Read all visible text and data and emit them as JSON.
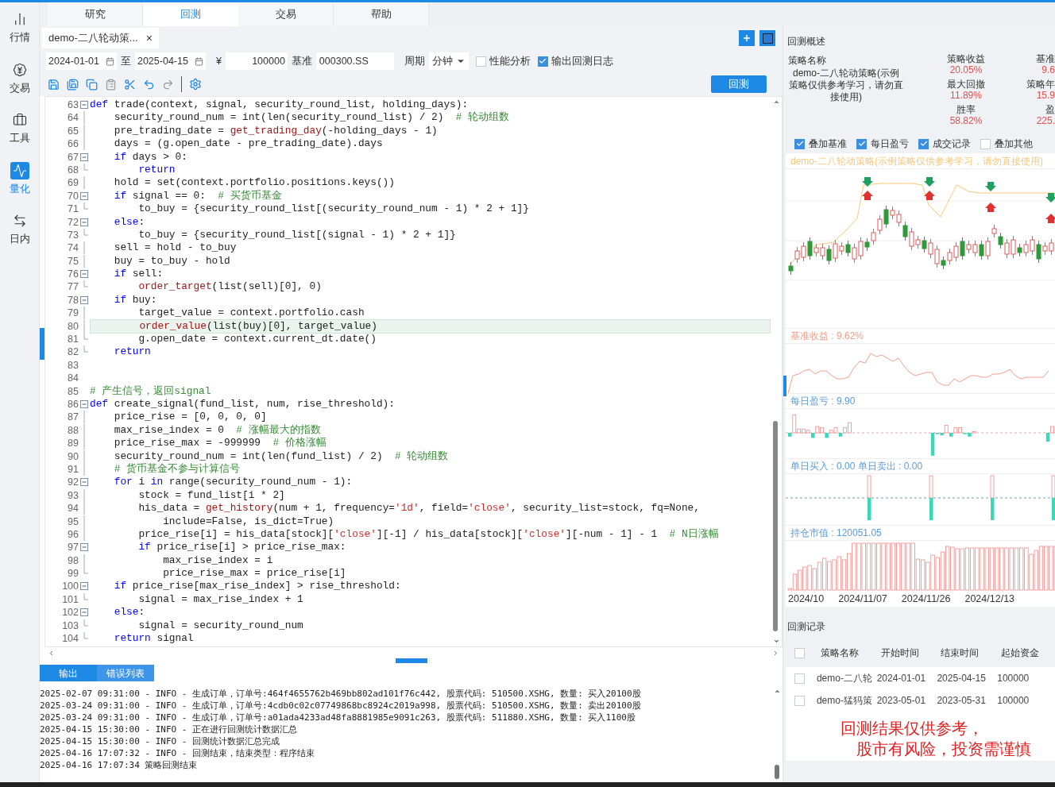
{
  "sidebar": {
    "items": [
      {
        "label": "行情",
        "selected": false
      },
      {
        "label": "交易",
        "selected": false
      },
      {
        "label": "工具",
        "selected": false
      },
      {
        "label": "量化",
        "selected": true
      },
      {
        "label": "日内",
        "selected": false
      }
    ]
  },
  "top_tabs": [
    {
      "label": "研究",
      "selected": false
    },
    {
      "label": "回测",
      "selected": true
    },
    {
      "label": "交易",
      "selected": false
    },
    {
      "label": "帮助",
      "selected": false
    }
  ],
  "editor": {
    "file_tab": {
      "label": "demo-二八轮动策...",
      "close": "×"
    },
    "params": {
      "start_date": "2024-01-01",
      "to": "至",
      "end_date": "2025-04-15",
      "currency": "¥",
      "capital": "100000",
      "benchmark_label": "基准",
      "benchmark": "000300.SS",
      "period_label": "周期",
      "period": "分钟",
      "perf": {
        "label": "性能分析",
        "checked": false
      },
      "log": {
        "label": "输出回测日志",
        "checked": true
      }
    },
    "run_button": "回测",
    "lines": [
      {
        "n": "63",
        "kind": "fold_start",
        "segs": [
          {
            "kind": "kw",
            "text": "def"
          },
          {
            "kind": "p",
            "text": " trade(context, signal, security_round_list, holding_days):"
          }
        ]
      },
      {
        "n": "64",
        "kind": "fold_body",
        "segs": [
          {
            "kind": "p",
            "text": "    security_round_num = int(len(security_round_list) / 2)  "
          },
          {
            "kind": "cm",
            "text": "# 轮动组数"
          }
        ]
      },
      {
        "n": "65",
        "kind": "fold_body",
        "segs": [
          {
            "kind": "p",
            "text": "    pre_trading_date = "
          },
          {
            "kind": "fn",
            "text": "get_trading_day"
          },
          {
            "kind": "p",
            "text": "(-holding_days - 1)"
          }
        ]
      },
      {
        "n": "66",
        "kind": "fold_body",
        "segs": [
          {
            "kind": "p",
            "text": "    days = (g.open_date - pre_trading_date).days"
          }
        ]
      },
      {
        "n": "67",
        "kind": "fold_start",
        "segs": [
          {
            "kind": "kw",
            "text": "    if"
          },
          {
            "kind": "p",
            "text": " days > 0:"
          }
        ]
      },
      {
        "n": "68",
        "kind": "fold_end",
        "segs": [
          {
            "kind": "kw",
            "text": "        return"
          }
        ]
      },
      {
        "n": "69",
        "kind": "fold_body",
        "segs": [
          {
            "kind": "p",
            "text": "    hold = set(context.portfolio.positions.keys())"
          }
        ]
      },
      {
        "n": "70",
        "kind": "fold_start",
        "segs": [
          {
            "kind": "kw",
            "text": "    if"
          },
          {
            "kind": "p",
            "text": " signal == 0:  "
          },
          {
            "kind": "cm",
            "text": "# 买货币基金"
          }
        ]
      },
      {
        "n": "71",
        "kind": "fold_end",
        "segs": [
          {
            "kind": "p",
            "text": "        to_buy = {security_round_list[(security_round_num - 1) * 2 + 1]}"
          }
        ]
      },
      {
        "n": "72",
        "kind": "fold_start",
        "segs": [
          {
            "kind": "kw",
            "text": "    else"
          },
          {
            "kind": "p",
            "text": ":"
          }
        ]
      },
      {
        "n": "73",
        "kind": "fold_end",
        "segs": [
          {
            "kind": "p",
            "text": "        to_buy = {security_round_list[(signal - 1) * 2 + 1]}"
          }
        ]
      },
      {
        "n": "74",
        "kind": "fold_body",
        "segs": [
          {
            "kind": "p",
            "text": "    sell = hold - to_buy"
          }
        ]
      },
      {
        "n": "75",
        "kind": "fold_body",
        "segs": [
          {
            "kind": "p",
            "text": "    buy = to_buy - hold"
          }
        ]
      },
      {
        "n": "76",
        "kind": "fold_start",
        "segs": [
          {
            "kind": "kw",
            "text": "    if"
          },
          {
            "kind": "p",
            "text": " sell:"
          }
        ]
      },
      {
        "n": "77",
        "kind": "fold_end",
        "segs": [
          {
            "kind": "fn",
            "text": "        order_target"
          },
          {
            "kind": "p",
            "text": "(list(sell)[0], 0)"
          }
        ]
      },
      {
        "n": "78",
        "kind": "fold_start",
        "segs": [
          {
            "kind": "kw",
            "text": "    if"
          },
          {
            "kind": "p",
            "text": " buy:"
          }
        ]
      },
      {
        "n": "79",
        "kind": "fold_body",
        "segs": [
          {
            "kind": "p",
            "text": "        target_value = context.portfolio.cash"
          }
        ]
      },
      {
        "n": "80",
        "kind": "fold_body",
        "current": true,
        "segs": [
          {
            "kind": "fn",
            "text": "        order_value"
          },
          {
            "kind": "p",
            "text": "(list(buy)[0], target_value)"
          }
        ]
      },
      {
        "n": "81",
        "kind": "fold_end",
        "segs": [
          {
            "kind": "p",
            "text": "        g.open_date = context.current_dt.date()"
          }
        ]
      },
      {
        "n": "82",
        "kind": "fold_end",
        "segs": [
          {
            "kind": "kw",
            "text": "    return"
          }
        ]
      },
      {
        "n": "83",
        "kind": "plain"
      },
      {
        "n": "84",
        "kind": "plain"
      },
      {
        "n": "85",
        "kind": "plain",
        "segs": [
          {
            "kind": "cm",
            "text": "# 产生信号，返回signal"
          }
        ]
      },
      {
        "n": "86",
        "kind": "fold_start",
        "segs": [
          {
            "kind": "kw",
            "text": "def"
          },
          {
            "kind": "p",
            "text": " create_signal(fund_list, num, rise_threshold):"
          }
        ]
      },
      {
        "n": "87",
        "kind": "fold_body",
        "segs": [
          {
            "kind": "p",
            "text": "    price_rise = [0, 0, 0, 0]"
          }
        ]
      },
      {
        "n": "88",
        "kind": "fold_body",
        "segs": [
          {
            "kind": "p",
            "text": "    max_rise_index = 0  "
          },
          {
            "kind": "cm",
            "text": "# 涨幅最大的指数"
          }
        ]
      },
      {
        "n": "89",
        "kind": "fold_body",
        "segs": [
          {
            "kind": "p",
            "text": "    price_rise_max = -999999  "
          },
          {
            "kind": "cm",
            "text": "# 价格涨幅"
          }
        ]
      },
      {
        "n": "90",
        "kind": "fold_body",
        "segs": [
          {
            "kind": "p",
            "text": "    security_round_num = int(len(fund_list) / 2)  "
          },
          {
            "kind": "cm",
            "text": "# 轮动组数"
          }
        ]
      },
      {
        "n": "91",
        "kind": "fold_body",
        "segs": [
          {
            "kind": "cm",
            "text": "    # 货币基金不参与计算信号"
          }
        ]
      },
      {
        "n": "92",
        "kind": "fold_start",
        "segs": [
          {
            "kind": "kw",
            "text": "    for"
          },
          {
            "kind": "p",
            "text": " i "
          },
          {
            "kind": "kw",
            "text": "in"
          },
          {
            "kind": "p",
            "text": " range(security_round_num - 1):"
          }
        ]
      },
      {
        "n": "93",
        "kind": "fold_body",
        "segs": [
          {
            "kind": "p",
            "text": "        stock = fund_list[i * 2]"
          }
        ]
      },
      {
        "n": "94",
        "kind": "fold_body",
        "segs": [
          {
            "kind": "p",
            "text": "        his_data = "
          },
          {
            "kind": "fn",
            "text": "get_history"
          },
          {
            "kind": "p",
            "text": "(num + 1, frequency="
          },
          {
            "kind": "str",
            "text": "'1d'"
          },
          {
            "kind": "p",
            "text": ", field="
          },
          {
            "kind": "str",
            "text": "'close'"
          },
          {
            "kind": "p",
            "text": ", security_list=stock, fq=None,"
          }
        ]
      },
      {
        "n": "95",
        "kind": "fold_body",
        "segs": [
          {
            "kind": "p",
            "text": "            include=False, is_dict=True)"
          }
        ]
      },
      {
        "n": "96",
        "kind": "fold_body",
        "segs": [
          {
            "kind": "p",
            "text": "        price_rise[i] = his_data[stock]["
          },
          {
            "kind": "str",
            "text": "'close'"
          },
          {
            "kind": "p",
            "text": "][-1] / his_data[stock]["
          },
          {
            "kind": "str",
            "text": "'close'"
          },
          {
            "kind": "p",
            "text": "][-num - 1] - 1  "
          },
          {
            "kind": "cm",
            "text": "# N日涨幅"
          }
        ]
      },
      {
        "n": "97",
        "kind": "fold_start",
        "segs": [
          {
            "kind": "kw",
            "text": "        if"
          },
          {
            "kind": "p",
            "text": " price_rise[i] > price_rise_max:"
          }
        ]
      },
      {
        "n": "98",
        "kind": "fold_body",
        "segs": [
          {
            "kind": "p",
            "text": "            max_rise_index = i"
          }
        ]
      },
      {
        "n": "99",
        "kind": "fold_end",
        "segs": [
          {
            "kind": "p",
            "text": "            price_rise_max = price_rise[i]"
          }
        ]
      },
      {
        "n": "100",
        "kind": "fold_start",
        "segs": [
          {
            "kind": "kw",
            "text": "    if"
          },
          {
            "kind": "p",
            "text": " price_rise[max_rise_index] > rise_threshold:"
          }
        ]
      },
      {
        "n": "101",
        "kind": "fold_end",
        "segs": [
          {
            "kind": "p",
            "text": "        signal = max_rise_index + 1"
          }
        ]
      },
      {
        "n": "102",
        "kind": "fold_start",
        "segs": [
          {
            "kind": "kw",
            "text": "    else"
          },
          {
            "kind": "p",
            "text": ":"
          }
        ]
      },
      {
        "n": "103",
        "kind": "fold_end",
        "segs": [
          {
            "kind": "p",
            "text": "        signal = security_round_num"
          }
        ]
      },
      {
        "n": "104",
        "kind": "fold_end",
        "segs": [
          {
            "kind": "kw",
            "text": "    return"
          },
          {
            "kind": "p",
            "text": " signal"
          }
        ]
      }
    ],
    "output_tabs": [
      {
        "label": "输出",
        "selected": true
      },
      {
        "label": "错误列表",
        "selected": false
      }
    ],
    "log": [
      "2025-02-07 09:31:00 - INFO - 生成订单，订单号:464f4655762b469bb802ad101f76c442, 股票代码: 510500.XSHG, 数量: 买入20100股",
      "2025-03-24 09:31:00 - INFO - 生成订单，订单号:4cdb0c02c07749868bc8924c2019a998, 股票代码: 510500.XSHG, 数量: 卖出20100股",
      "2025-03-24 09:31:00 - INFO - 生成订单，订单号:a01ada4233ad48fa8881985e9091c263, 股票代码: 511880.XSHG, 数量: 买入1100股",
      "2025-04-15 15:30:00 - INFO - 正在进行回测统计数据汇总",
      "2025-04-15 15:30:00 - INFO - 回测统计数据汇总完成",
      "2025-04-16 17:07:32 - INFO - 回测结束，结束类型：程序结束",
      "2025-04-16 17:07:34 策略回测结束"
    ]
  },
  "summary": {
    "title": "回测概述",
    "name_label": "策略名称",
    "name_value": "demo-二八轮动策略(示例策略仅供参考学习，请勿直接使用)",
    "stats": [
      {
        "label": "策略收益",
        "value": "20.05%"
      },
      {
        "label": "基准",
        "value": "9.6"
      },
      {
        "label": "最大回撤",
        "value": "11.89%"
      },
      {
        "label": "策略年",
        "value": "15.9"
      },
      {
        "label": "胜率",
        "value": "58.82%"
      },
      {
        "label": "盈",
        "value": "225."
      }
    ],
    "overlays": [
      {
        "label": "叠加基准",
        "checked": true
      },
      {
        "label": "每日盈亏",
        "checked": true
      },
      {
        "label": "成交记录",
        "checked": true
      },
      {
        "label": "叠加其他",
        "checked": false
      }
    ],
    "chart_title": "demo-二八轮动策略(示例策略仅供参考学习，请勿直接使用)",
    "panels": [
      {
        "kind": "line",
        "label": "基准收益 : 9.62%",
        "color": "#f0a08a"
      },
      {
        "kind": "pnl",
        "label": "每日盈亏 : 9.90",
        "color": "#5b9bd5"
      },
      {
        "kind": "trades",
        "label": "单日买入 : 0.00 单日卖出 : 0.00",
        "color": "#5b9bd5"
      },
      {
        "kind": "holdings",
        "label": "持仓市值 : 120051.05",
        "color": "#5b9bd5"
      }
    ],
    "x_labels": [
      "2024/10",
      "2024/11/07",
      "2024/11/26",
      "2024/12/13"
    ]
  },
  "records": {
    "title": "回测记录",
    "select_all": {
      "checked": false
    },
    "columns": [
      "策略名称",
      "开始时间",
      "结束时间",
      "起始资金"
    ],
    "rows": [
      {
        "checked": false,
        "cells": [
          "demo-二八轮",
          "2024-01-01",
          "2025-04-15",
          "100000"
        ]
      },
      {
        "checked": false,
        "cells": [
          "demo-猛犸策",
          "2023-05-01",
          "2023-05-31",
          "100000"
        ]
      }
    ],
    "notice": [
      "回测结果仅供参考，",
      "股市有风险，投资需谨慎"
    ]
  }
}
